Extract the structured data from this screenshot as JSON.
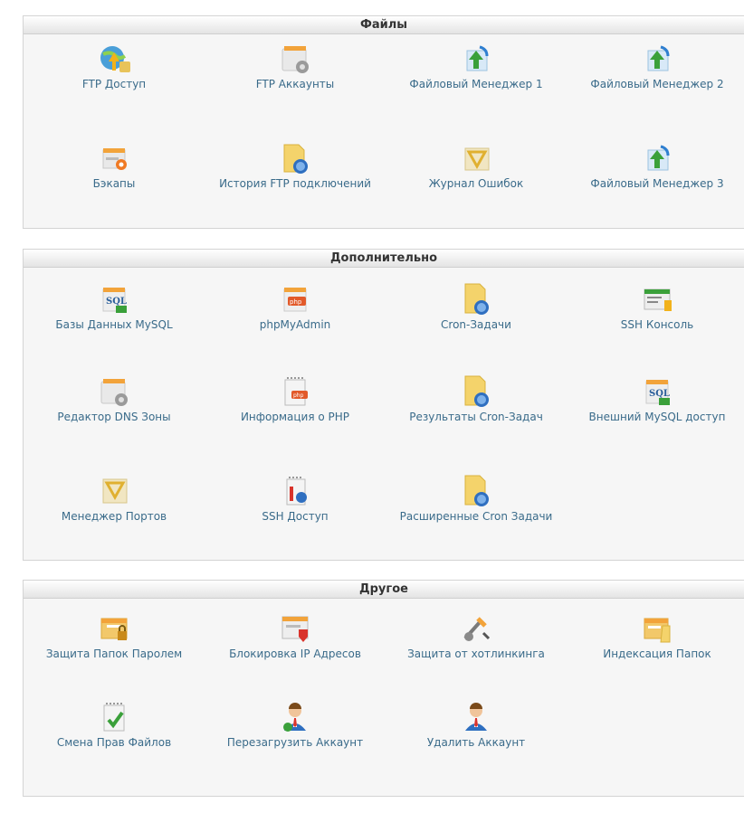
{
  "sections": [
    {
      "title": "Файлы",
      "items": [
        {
          "label": "FTP Доступ",
          "icon": "ftp-access-icon"
        },
        {
          "label": "FTP Аккаунты",
          "icon": "ftp-accounts-icon"
        },
        {
          "label": "Файловый Менеджер 1",
          "icon": "file-manager-icon"
        },
        {
          "label": "Файловый Менеджер 2",
          "icon": "file-manager-icon"
        },
        {
          "label": "Бэкапы",
          "icon": "backups-icon"
        },
        {
          "label": "История FTP подключений",
          "icon": "ftp-history-icon"
        },
        {
          "label": "Журнал Ошибок",
          "icon": "error-log-icon"
        },
        {
          "label": "Файловый Менеджер 3",
          "icon": "file-manager-icon"
        }
      ]
    },
    {
      "title": "Дополнительно",
      "items": [
        {
          "label": "Базы Данных MySQL",
          "icon": "mysql-databases-icon"
        },
        {
          "label": "phpMyAdmin",
          "icon": "phpmyadmin-icon"
        },
        {
          "label": "Cron-Задачи",
          "icon": "cron-jobs-icon"
        },
        {
          "label": "SSH Консоль",
          "icon": "ssh-console-icon"
        },
        {
          "label": "Редактор DNS Зоны",
          "icon": "dns-zone-editor-icon"
        },
        {
          "label": "Информация о PHP",
          "icon": "php-info-icon"
        },
        {
          "label": "Результаты Cron-Задач",
          "icon": "cron-results-icon"
        },
        {
          "label": "Внешний MySQL доступ",
          "icon": "remote-mysql-icon"
        },
        {
          "label": "Менеджер Портов",
          "icon": "port-manager-icon"
        },
        {
          "label": "SSH Доступ",
          "icon": "ssh-access-icon"
        },
        {
          "label": "Расширенные Cron Задачи",
          "icon": "advanced-cron-icon"
        }
      ]
    },
    {
      "title": "Другое",
      "items": [
        {
          "label": "Защита Папок Паролем",
          "icon": "password-protect-icon"
        },
        {
          "label": "Блокировка IP Адресов",
          "icon": "ip-blocker-icon"
        },
        {
          "label": "Защита от хотлинкинга",
          "icon": "hotlink-protection-icon"
        },
        {
          "label": "Индексация Папок",
          "icon": "directory-indexing-icon"
        },
        {
          "label": "Смена Прав Файлов",
          "icon": "file-permissions-icon"
        },
        {
          "label": "Перезагрузить Аккаунт",
          "icon": "reload-account-icon"
        },
        {
          "label": "Удалить Аккаунт",
          "icon": "delete-account-icon"
        }
      ]
    }
  ]
}
